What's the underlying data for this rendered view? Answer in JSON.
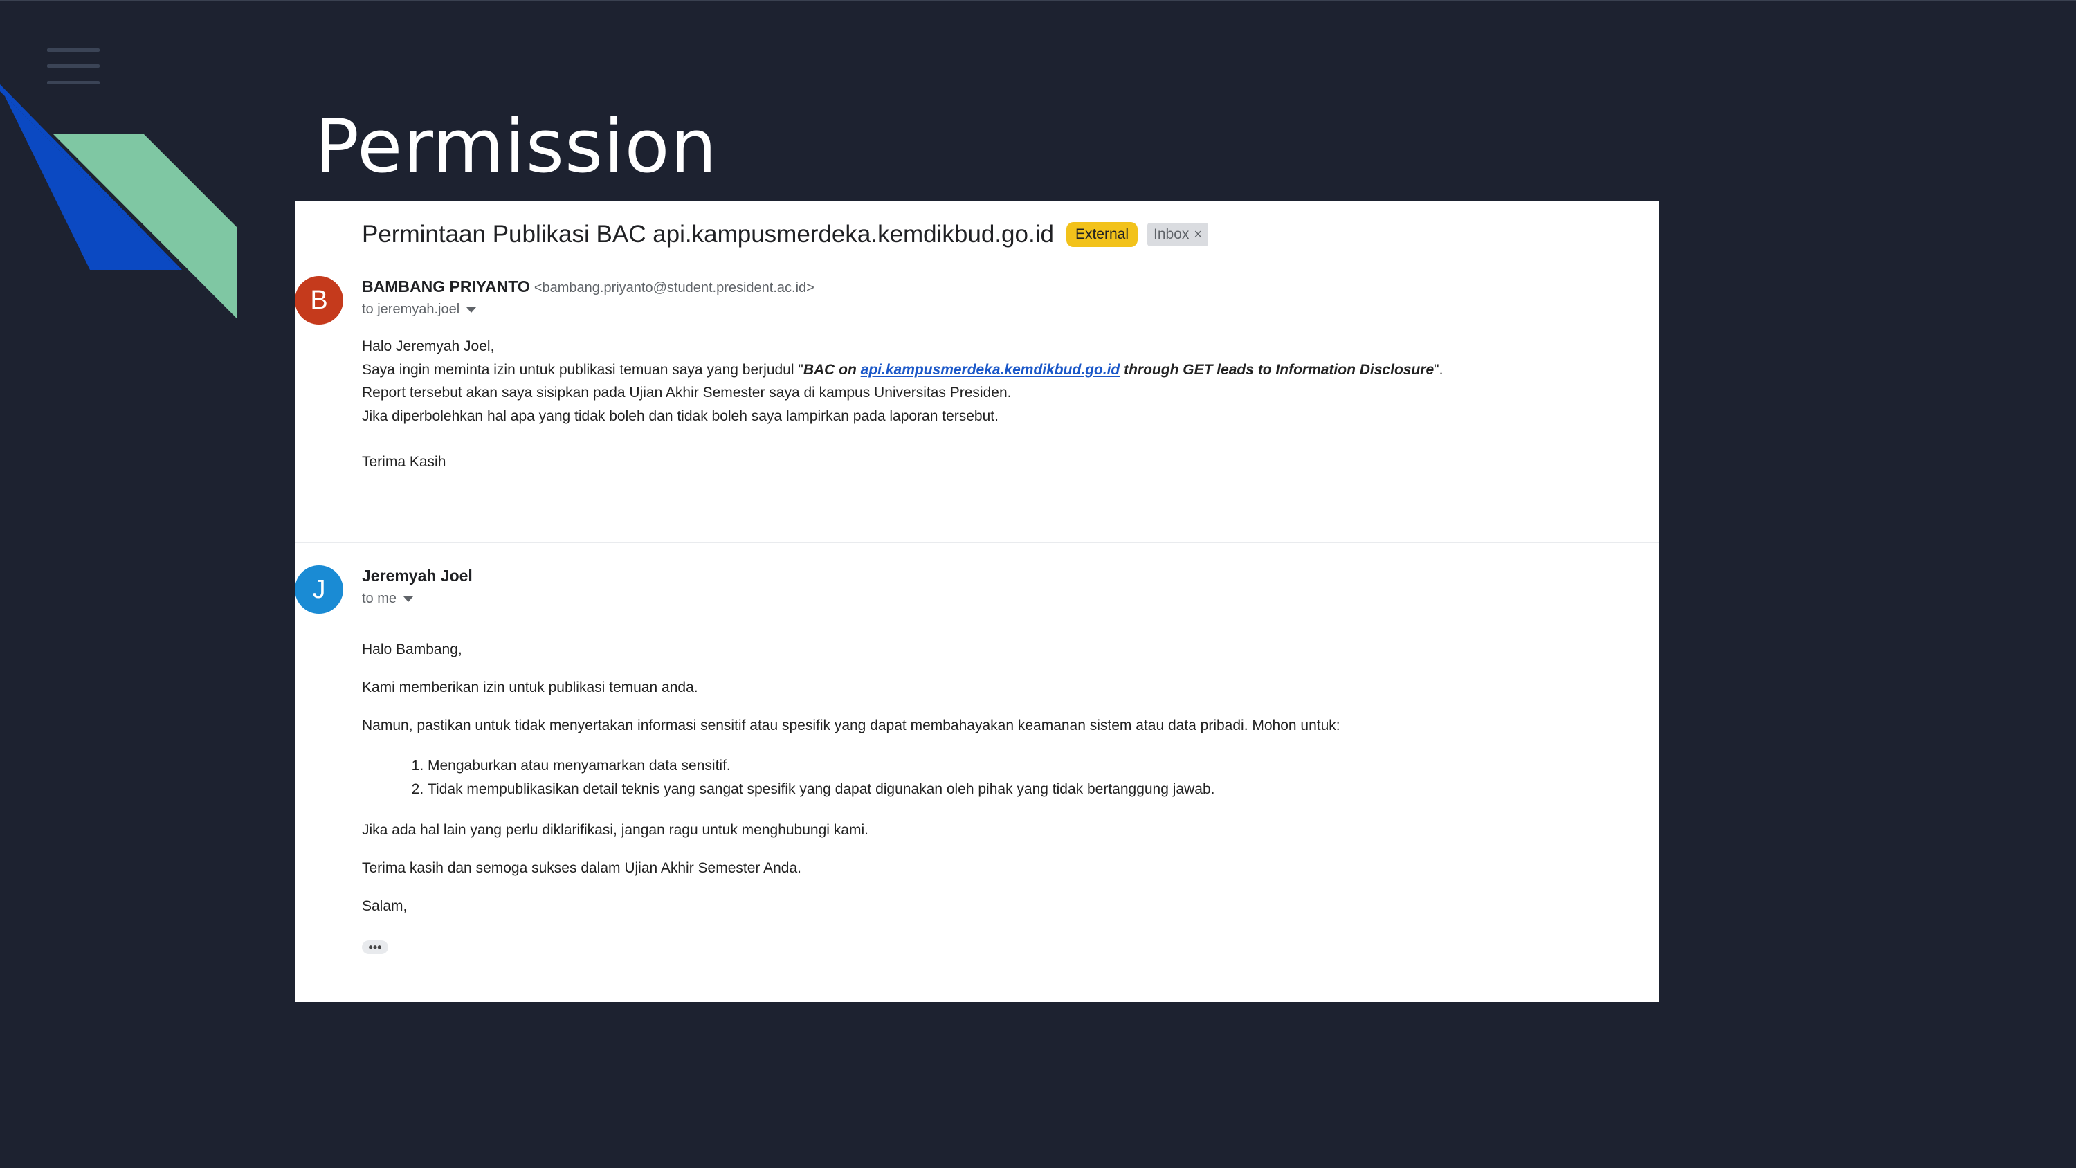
{
  "slide": {
    "title": "Permission"
  },
  "icons": {
    "menu": "menu-icon",
    "decoration": "diagonal-stripes"
  },
  "colors": {
    "background": "#1d2230",
    "stripe_blue": "#0b49c2",
    "stripe_green": "#7fc7a3",
    "badge_external": "#f2c21b",
    "avatar_b": "#c53a1c",
    "avatar_j": "#1a8bd4",
    "link": "#1a57c8"
  },
  "email": {
    "subject": "Permintaan Publikasi BAC api.kampusmerdeka.kemdikbud.go.id",
    "badge_external": "External",
    "badge_inbox": "Inbox",
    "badge_inbox_close": "×",
    "message1": {
      "avatar_letter": "B",
      "sender_name": "BAMBANG PRIYANTO",
      "sender_email": "<bambang.priyanto@student.president.ac.id>",
      "recipient": "to jeremyah.joel",
      "greeting": "Halo Jeremyah Joel,",
      "line1_before": "Saya ingin meminta izin untuk publikasi temuan saya yang berjudul \"",
      "line1_bold1": "BAC on ",
      "line1_link": "api.kampusmerdeka.kemdikbud.go.id",
      "line1_bold2": " through GET leads to Information Disclosure",
      "line1_after": "\".",
      "line2": "Report tersebut akan saya sisipkan pada Ujian Akhir Semester saya di kampus Universitas Presiden.",
      "line3": "Jika diperbolehkan hal apa yang tidak boleh dan tidak boleh saya lampirkan pada laporan tersebut.",
      "closing": "Terima Kasih"
    },
    "message2": {
      "avatar_letter": "J",
      "sender_name": "Jeremyah Joel",
      "recipient": "to me",
      "greeting": "Halo Bambang,",
      "para1": "Kami memberikan izin untuk publikasi temuan anda.",
      "para2": "Namun, pastikan untuk tidak menyertakan informasi sensitif atau spesifik yang dapat membahayakan keamanan sistem atau data pribadi. Mohon untuk:",
      "list": [
        "Mengaburkan atau menyamarkan data sensitif.",
        "Tidak mempublikasikan detail teknis yang sangat spesifik yang dapat digunakan oleh pihak yang tidak bertanggung jawab."
      ],
      "para3": "Jika ada hal lain yang perlu diklarifikasi, jangan ragu untuk menghubungi kami.",
      "para4": "Terima kasih dan semoga sukses dalam Ujian Akhir Semester Anda.",
      "signoff": "Salam,",
      "more": "•••"
    }
  }
}
